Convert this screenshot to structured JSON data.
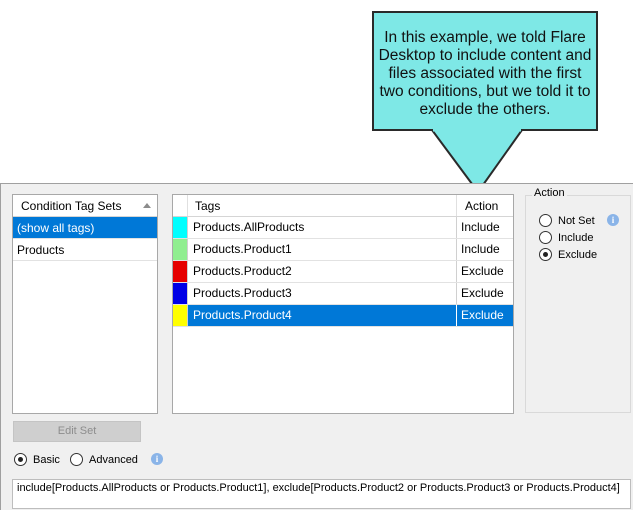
{
  "callout": {
    "text": "In this example, we told Flare Desktop to include content and files associated with the first two conditions, but we told it to exclude the others."
  },
  "condition_tag_sets": {
    "header": "Condition Tag Sets",
    "items": [
      {
        "label": "(show all tags)",
        "selected": true
      },
      {
        "label": "Products",
        "selected": false
      }
    ]
  },
  "tags": {
    "header_tags": "Tags",
    "header_action": "Action",
    "rows": [
      {
        "name": "Products.AllProducts",
        "action": "Include",
        "color": "#00ffff",
        "selected": false
      },
      {
        "name": "Products.Product1",
        "action": "Include",
        "color": "#90ee90",
        "selected": false
      },
      {
        "name": "Products.Product2",
        "action": "Exclude",
        "color": "#e60000",
        "selected": false
      },
      {
        "name": "Products.Product3",
        "action": "Exclude",
        "color": "#0000e6",
        "selected": false
      },
      {
        "name": "Products.Product4",
        "action": "Exclude",
        "color": "#ffff00",
        "selected": true
      }
    ]
  },
  "action_group": {
    "legend": "Action",
    "options": [
      {
        "label": "Not Set",
        "checked": false
      },
      {
        "label": "Include",
        "checked": false
      },
      {
        "label": "Exclude",
        "checked": true
      }
    ]
  },
  "edit_set_label": "Edit Set",
  "mode": {
    "basic_label": "Basic",
    "advanced_label": "Advanced",
    "selected": "Basic"
  },
  "expression": "include[Products.AllProducts or Products.Product1], exclude[Products.Product2 or Products.Product3 or Products.Product4]",
  "colors": {
    "selection": "#0078d7",
    "callout": "#7ee8e6",
    "panel": "#f0f0f0"
  }
}
